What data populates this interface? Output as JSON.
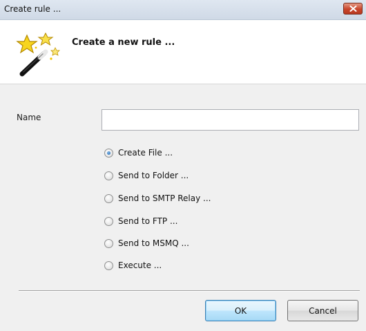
{
  "window": {
    "title": "Create rule ...",
    "close_icon": "close-icon"
  },
  "header": {
    "title": "Create a new rule ...",
    "icon": "magic-wand-icon"
  },
  "form": {
    "name_label": "Name",
    "name_value": "",
    "name_placeholder": ""
  },
  "options": {
    "selected": "Create File ...",
    "items": [
      {
        "label": "Create File ...",
        "checked": true
      },
      {
        "label": "Send to Folder ...",
        "checked": false
      },
      {
        "label": "Send to SMTP Relay ...",
        "checked": false
      },
      {
        "label": "Send to FTP ...",
        "checked": false
      },
      {
        "label": "Send to MSMQ ...",
        "checked": false
      },
      {
        "label": "Execute ...",
        "checked": false
      }
    ]
  },
  "buttons": {
    "ok_label": "OK",
    "cancel_label": "Cancel"
  }
}
